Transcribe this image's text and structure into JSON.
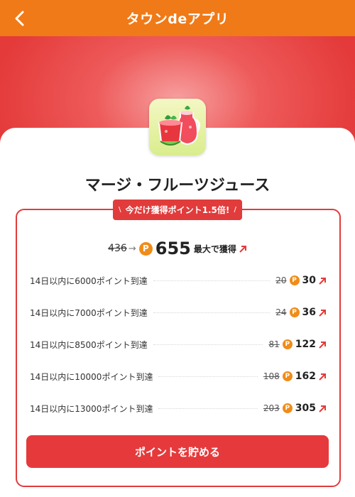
{
  "header": {
    "title": "タウンdeアプリ",
    "back_icon": "chevron-left-icon",
    "color": "#f07a17"
  },
  "app": {
    "name": "マージ・フルーツジュース",
    "icon": "watermelon-juice-icon"
  },
  "promo": {
    "badge": "今だけ獲得ポイント1.5倍!"
  },
  "summary": {
    "old_points": "436",
    "arrow": "→",
    "new_points": "655",
    "max_label": "最大で獲得"
  },
  "coin_symbol": "P",
  "rewards": [
    {
      "label": "14日以内に6000ポイント到達",
      "old": "20",
      "new": "30"
    },
    {
      "label": "14日以内に7000ポイント到達",
      "old": "24",
      "new": "36"
    },
    {
      "label": "14日以内に8500ポイント到達",
      "old": "81",
      "new": "122"
    },
    {
      "label": "14日以内に10000ポイント到達",
      "old": "108",
      "new": "162"
    },
    {
      "label": "14日以内に13000ポイント到達",
      "old": "203",
      "new": "305"
    }
  ],
  "cta": {
    "label": "ポイントを貯める"
  },
  "colors": {
    "accent": "#e23b3b",
    "coin": "#f08c1a"
  }
}
